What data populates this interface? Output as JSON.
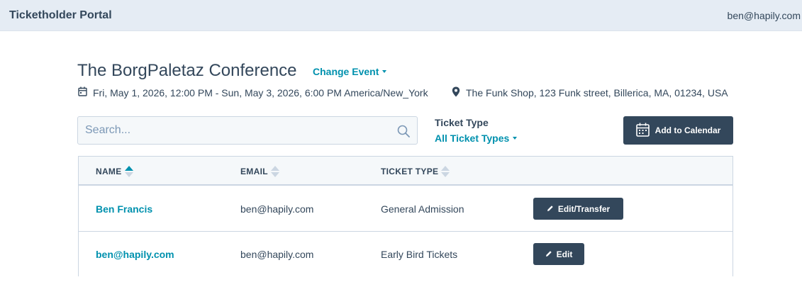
{
  "header": {
    "brand": "Ticketholder Portal",
    "user_email": "ben@hapily.com"
  },
  "event": {
    "title": "The BorgPaletaz Conference",
    "change_event_label": "Change Event",
    "date_range": "Fri, May 1, 2026, 12:00 PM - Sun, May 3, 2026, 6:00 PM America/New_York",
    "location": "The Funk Shop, 123 Funk street, Billerica, MA, 01234, USA"
  },
  "search": {
    "placeholder": "Search...",
    "value": ""
  },
  "filter": {
    "label": "Ticket Type",
    "selected": "All Ticket Types"
  },
  "actions": {
    "add_to_calendar": "Add to Calendar"
  },
  "table": {
    "columns": [
      "NAME",
      "EMAIL",
      "TICKET TYPE"
    ],
    "sorted_column": "NAME",
    "rows": [
      {
        "name": "Ben Francis",
        "email": "ben@hapily.com",
        "ticket_type": "General Admission",
        "action": "Edit/Transfer"
      },
      {
        "name": "ben@hapily.com",
        "email": "ben@hapily.com",
        "ticket_type": "Early Bird Tickets",
        "action": "Edit"
      }
    ]
  },
  "colors": {
    "accent": "#0091ae",
    "primary_dark": "#33475b",
    "header_bg": "#e5ecf4",
    "border": "#cbd6e2"
  },
  "icons": {
    "calendar": "calendar-icon",
    "location": "map-pin-icon",
    "search": "search-icon",
    "pencil": "pencil-icon",
    "caret": "caret-down-icon",
    "sort": "sort-icon"
  }
}
